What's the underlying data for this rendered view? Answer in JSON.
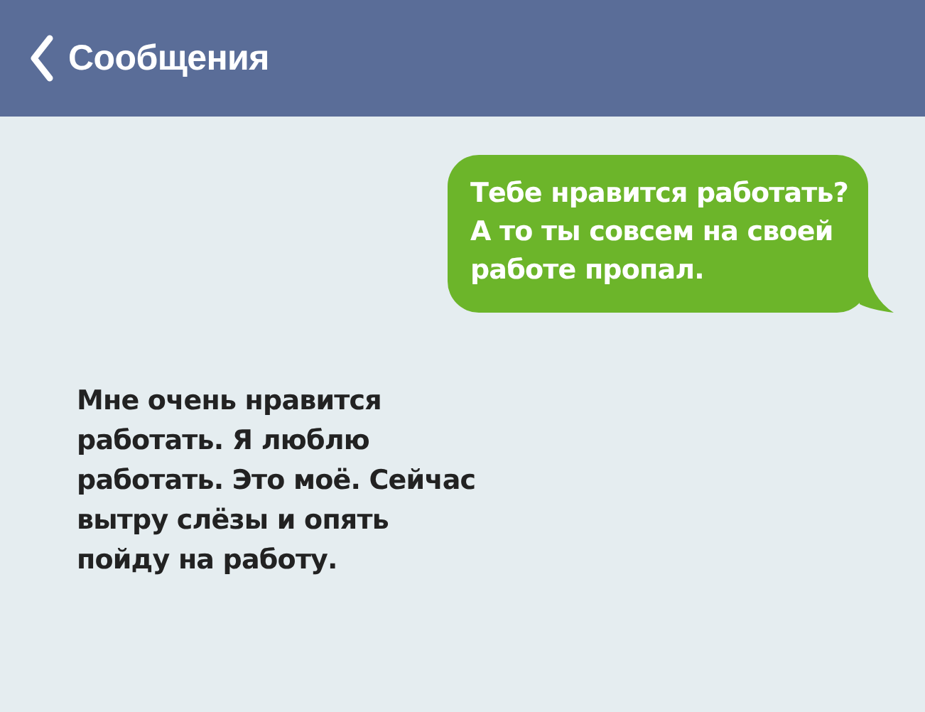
{
  "header": {
    "title": "Сообщения"
  },
  "messages": [
    {
      "kind": "outgoing",
      "text": "Тебе нравится работать?\nА то ты совсем на своей\nработе пропал."
    },
    {
      "kind": "incoming",
      "text": "Мне очень нравится\nработать. Я люблю\nработать. Это моё. Сейчас\nвытру слёзы и опять\nпойду на работу."
    }
  ]
}
